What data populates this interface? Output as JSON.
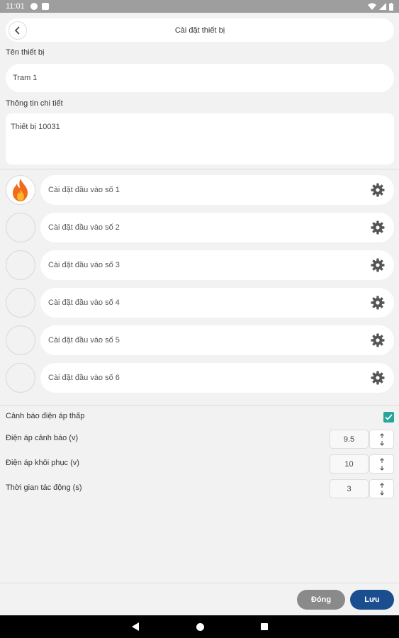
{
  "status_bar": {
    "time": "11:01",
    "icons": [
      "notification-icon",
      "notification-icon",
      "wifi-icon",
      "signal-icon",
      "battery-icon"
    ]
  },
  "header": {
    "title": "Cài đặt thiết bị",
    "back_icon": "chevron-left-icon"
  },
  "device_name": {
    "label": "Tên thiết bị",
    "value": "Tram 1"
  },
  "details": {
    "label": "Thông tin chi tiết",
    "value": "Thiết bị 10031"
  },
  "inputs": [
    {
      "label": "Cài đặt đầu vào số 1",
      "icon": "fire-icon",
      "active": true
    },
    {
      "label": "Cài đặt đầu vào số 2",
      "icon": "",
      "active": false
    },
    {
      "label": "Cài đặt đầu vào số 3",
      "icon": "",
      "active": false
    },
    {
      "label": "Cài đặt đầu vào số 4",
      "icon": "",
      "active": false
    },
    {
      "label": "Cài đặt đầu vào số 5",
      "icon": "",
      "active": false
    },
    {
      "label": "Cài đặt đầu vào số 6",
      "icon": "",
      "active": false
    }
  ],
  "low_voltage": {
    "label": "Cảnh báo điện áp thấp",
    "checked": true,
    "accent_color": "#26a69a",
    "warning_voltage": {
      "label": "Điện áp cảnh báo (v)",
      "value": "9.5"
    },
    "recovery_voltage": {
      "label": "Điện áp khôi phục (v)",
      "value": "10"
    },
    "action_time": {
      "label": "Thời gian tác động (s)",
      "value": "3"
    }
  },
  "footer": {
    "close_label": "Đóng",
    "save_label": "Lưu",
    "close_color": "#8a8a8a",
    "save_color": "#1b4e8f"
  },
  "nav_bar": {
    "icons": [
      "back-triangle-icon",
      "home-circle-icon",
      "recents-square-icon"
    ]
  }
}
